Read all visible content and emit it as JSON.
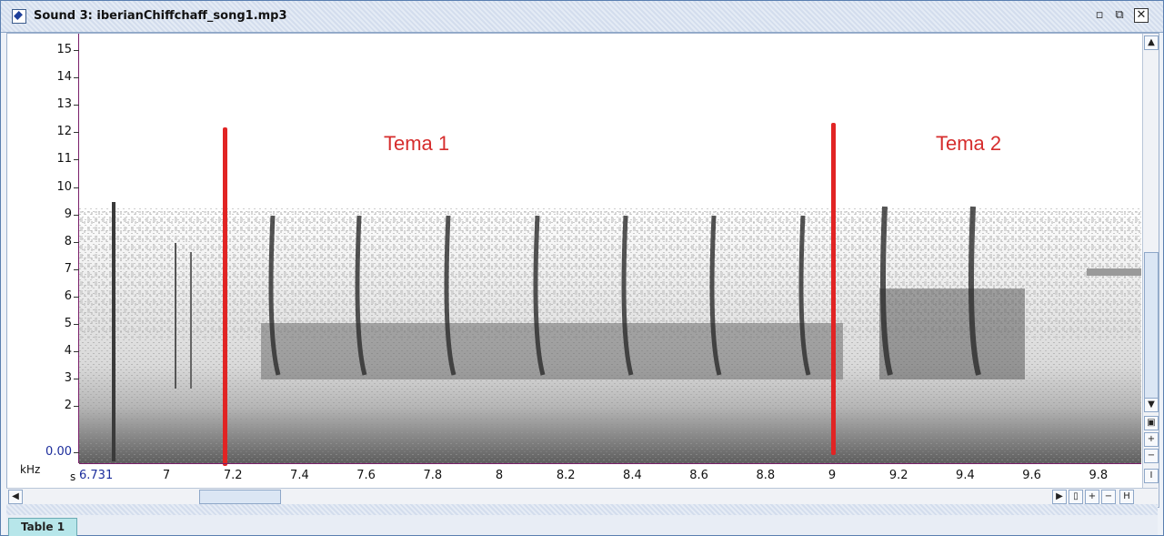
{
  "window": {
    "title": "Sound 3: iberianChiffchaff_song1.mp3",
    "minimize_label": "▫",
    "maximize_label": "⧉",
    "close_label": "✕"
  },
  "yaxis": {
    "unit": "kHz",
    "ticks": [
      "15",
      "14",
      "13",
      "12",
      "11",
      "10",
      "9",
      "8",
      "7",
      "6",
      "5",
      "4",
      "3",
      "2",
      "0.00"
    ]
  },
  "xaxis": {
    "unit": "s",
    "start": "6.731",
    "ticks": [
      "7",
      "7.2",
      "7.4",
      "7.6",
      "7.8",
      "8",
      "8.2",
      "8.4",
      "8.6",
      "8.8",
      "9",
      "9.2",
      "9.4",
      "9.6",
      "9.8"
    ]
  },
  "annotations": {
    "theme1": "Tema 1",
    "theme2": "Tema 2",
    "color": "#d62d2d"
  },
  "tabs": [
    {
      "label": "Table 1"
    }
  ],
  "controls": {
    "zoom_in": "+",
    "zoom_out": "−",
    "fit_vertical": "I",
    "fit_horizontal": "H",
    "scroll_up": "▲",
    "scroll_down": "▼",
    "scroll_left": "◀",
    "scroll_right": "▶"
  }
}
